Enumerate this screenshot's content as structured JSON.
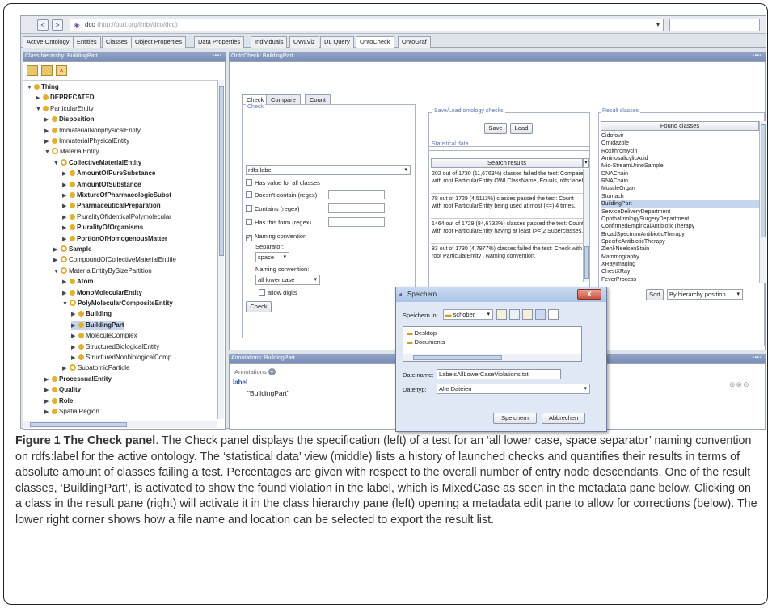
{
  "toolbar": {
    "back": "<",
    "forward": ">",
    "ontology_name": "dco",
    "ontology_url": "(http://purl.org/imbi/dco/dco)",
    "dropdown_arrow": "▾",
    "warning": "▲"
  },
  "tabs": [
    "Active Ontology",
    "Entities",
    "Classes",
    "Object Properties",
    "Data Properties",
    "Individuals",
    "OWLViz",
    "DL Query",
    "OntoCheck",
    "OntoGraf"
  ],
  "active_tab": "OntoCheck",
  "class_hierarchy": {
    "header": "Class hierarchy: BuildingPart",
    "items": [
      {
        "label": "Thing",
        "bold": true,
        "level": 0
      },
      {
        "label": "DEPRECATED",
        "bold": true,
        "level": 1
      },
      {
        "label": "ParticularEntity",
        "bold": false,
        "level": 1
      },
      {
        "label": "Disposition",
        "bold": true,
        "level": 2
      },
      {
        "label": "ImmaterialNonphysicalEntity",
        "bold": false,
        "level": 2
      },
      {
        "label": "ImmaterialPhysicalEntity",
        "bold": false,
        "level": 2
      },
      {
        "label": "MaterialEntity",
        "bold": false,
        "level": 2
      },
      {
        "label": "CollectiveMaterialEntity",
        "bold": true,
        "level": 3
      },
      {
        "label": "AmountOfPureSubstance",
        "bold": true,
        "level": 4
      },
      {
        "label": "AmountOfSubstance",
        "bold": true,
        "level": 4
      },
      {
        "label": "MixtureOfPharmacologicSubst",
        "bold": true,
        "level": 4
      },
      {
        "label": "PharmaceuticalPreparation",
        "bold": true,
        "level": 4
      },
      {
        "label": "PluralityOfIdenticalPolymolecular",
        "bold": false,
        "level": 4
      },
      {
        "label": "PluralityOfOrganisms",
        "bold": true,
        "level": 4
      },
      {
        "label": "PortionOfHomogenousMatter",
        "bold": true,
        "level": 4
      },
      {
        "label": "Sample",
        "bold": true,
        "level": 3
      },
      {
        "label": "CompoundOfCollectiveMaterialEntitie",
        "bold": false,
        "level": 3
      },
      {
        "label": "MaterialEntityBySizePartition",
        "bold": false,
        "level": 3
      },
      {
        "label": "Atom",
        "bold": true,
        "level": 4
      },
      {
        "label": "MonoMolecularEntity",
        "bold": true,
        "level": 4
      },
      {
        "label": "PolyMolecularCompositeEntity",
        "bold": true,
        "level": 4
      },
      {
        "label": "Building",
        "bold": true,
        "level": 5
      },
      {
        "label": "BuildingPart",
        "bold": true,
        "level": 5
      },
      {
        "label": "MoleculeComplex",
        "bold": false,
        "level": 5
      },
      {
        "label": "StructuredBiologicalEntity",
        "bold": false,
        "level": 5
      },
      {
        "label": "StructuredNonbiologicalComp",
        "bold": false,
        "level": 5
      },
      {
        "label": "SubatomicParticle",
        "bold": false,
        "level": 4
      },
      {
        "label": "ProcessualEntity",
        "bold": true,
        "level": 2
      },
      {
        "label": "Quality",
        "bold": true,
        "level": 2
      },
      {
        "label": "Role",
        "bold": true,
        "level": 2
      },
      {
        "label": "SpatialRegion",
        "bold": false,
        "level": 2
      }
    ]
  },
  "ontocheck": {
    "header": "OntoCheck: BuildingPart",
    "subtabs": [
      "Check",
      "Compare",
      "Count"
    ],
    "check_group_label": "Check",
    "property_select": "rdfs:label",
    "options": {
      "has_value": "Has value for all classes",
      "doesnt_contain": "Doesn't contain (regex)",
      "contains": "Contains (regex)",
      "has_form": "Has this form (regex)",
      "naming_convention": "Naming convention",
      "separator_label": "Separator:",
      "separator_value": "space",
      "naming_label": "Naming convention:",
      "naming_value": "all lower case",
      "allow_digits": "allow digits"
    },
    "check_button": "Check"
  },
  "saveload": {
    "label": "Save/Load ontology checks",
    "save": "Save",
    "load": "Load"
  },
  "statistical": {
    "label": "Statistical data",
    "header": "Search results",
    "results": [
      "202 out of 1730 (11,6763%) classes failed the test: Compare with root ParticularEntity OWLClassName, Equals, rdfs:label.",
      "78 out of 1729 (4,5113%) classes passed the test: Count with root ParticularEntity being used at most (<=) 4 times.",
      "1464 out of 1729 (84,6732%) classes passed the test: Count with root ParticularEntity having at least (>=)2 Superclasses.",
      "83 out of 1730 (4,7977%) classes failed the test: Check with root ParticularEntity , Naming convention."
    ]
  },
  "results": {
    "label": "Result classes",
    "header": "Found classes",
    "items": [
      "Cidofovir",
      "Ornidazole",
      "Roxithromycin",
      "AminosalicylicAcid",
      "Mid-StreamUrineSample",
      "DNAChain",
      "RNAChain",
      "MuscleOrgan",
      "Stomach",
      "BuildingPart",
      "ServiceDeliveryDepartment",
      "OphthalmologySurgeryDepartment",
      "ConfirmedEmpiricalAntibioticTherapy",
      "BroadSpectrumAntibioticTherapy",
      "SpecificAntibioticTherapy",
      "Ziehl-NeelsenStain",
      "Mammography",
      "XRayImaging",
      "ChestXRay",
      "FeverProcess"
    ],
    "selected": "BuildingPart",
    "sort_button": "Sort",
    "sort_select": "By hierarchy position"
  },
  "annotations": {
    "header": "Annotations: BuildingPart",
    "label_caption": "Annotations",
    "property": "label",
    "value": "\"BuildingPart\""
  },
  "dialog": {
    "title": "Speichern",
    "save_in_label": "Speichern in:",
    "save_in_value": "schober",
    "folders": [
      "Desktop",
      "Documents"
    ],
    "filename_label": "Dateiname:",
    "filename_value": "LabelsAllLowerCaseViolations.txt",
    "filetype_label": "Dateityp:",
    "filetype_value": "Alle Dateien",
    "save_button": "Speichern",
    "cancel_button": "Abbrechen",
    "close": "X"
  },
  "caption": {
    "title": "Figure 1 The Check panel",
    "text": ". The Check panel displays the specification (left) of a test for an ‘all lower case, space separator’ naming convention on rdfs:label for the active ontology. The ‘statistical data’ view (middle) lists a history of launched checks and quantifies their results in terms of absolute amount of classes failing a test. Percentages are given with respect to the overall number of entry node descendants. One of the result classes, ‘BuildingPart’, is activated to show the found violation in the label, which is MixedCase as seen in the metadata pane below. Clicking on a class in the result pane (right) will activate it in the class hierarchy pane (left) opening a metadata edit pane to allow for corrections (below). The lower right corner shows how a file name and location can be selected to export the result list."
  },
  "colors": {
    "panel_header": "#7a8fb8",
    "class_dot": "#e2b030",
    "selection": "#c5d5ee"
  }
}
